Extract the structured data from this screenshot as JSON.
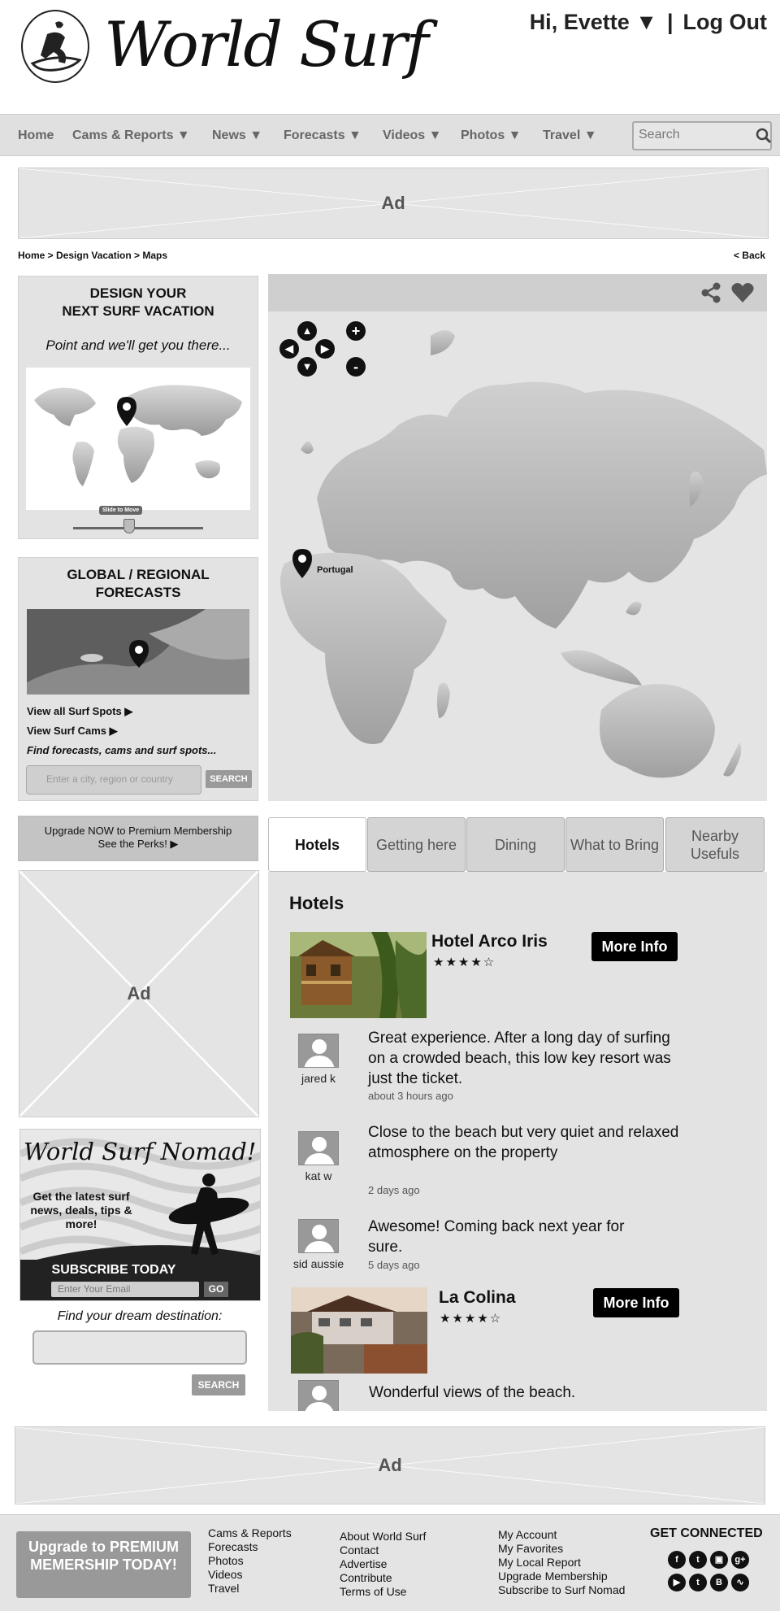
{
  "header": {
    "logo_text": "World Surf",
    "greeting": "Hi, Evette ▼",
    "separator": "|",
    "logout": "Log Out"
  },
  "nav": {
    "items": [
      "Home",
      "Cams & Reports ▼",
      "News ▼",
      "Forecasts ▼",
      "Videos ▼",
      "Photos ▼",
      "Travel ▼"
    ],
    "search_placeholder": "Search"
  },
  "ads": {
    "label": "Ad"
  },
  "breadcrumb": "Home > Design Vacation > Maps",
  "back": "< Back",
  "design_panel": {
    "title_line1": "DESIGN YOUR",
    "title_line2": "NEXT SURF VACATION",
    "tagline": "Point and we'll get you there...",
    "slider_label": "Slide to Move"
  },
  "forecast_panel": {
    "title_line1": "GLOBAL / REGIONAL",
    "title_line2": "FORECASTS",
    "link_spots": "View all Surf Spots ▶",
    "link_cams": "View Surf Cams ▶",
    "find_text": "Find forecasts, cams and surf spots...",
    "input_placeholder": "Enter a city, region or country",
    "search_button": "SEARCH"
  },
  "map": {
    "pin_label": "Portugal",
    "zoom_in": "+",
    "zoom_out": "-"
  },
  "promo": {
    "line1": "Upgrade NOW to Premium Membership",
    "line2": "See the Perks! ▶"
  },
  "tabs": [
    {
      "label": "Hotels",
      "active": true
    },
    {
      "label": "Getting here",
      "active": false
    },
    {
      "label": "Dining",
      "active": false
    },
    {
      "label": "What to Bring",
      "active": false
    },
    {
      "label": "Nearby Usefuls",
      "active": false
    }
  ],
  "hotels_section": {
    "title": "Hotels",
    "hotels": [
      {
        "name": "Hotel Arco Iris",
        "stars": "★★★★☆",
        "rating": 4,
        "button": "More Info",
        "reviews": [
          {
            "user": "jared k",
            "text": "Great experience. After a long day of surfing on a crowded beach, this low key resort was just the ticket.",
            "time": "about 3 hours ago"
          },
          {
            "user": "kat w",
            "text": "Close to the beach but very quiet and relaxed atmosphere on the property",
            "time": "2 days ago"
          },
          {
            "user": "sid aussie",
            "text": "Awesome! Coming back next year for sure.",
            "time": "5 days ago"
          }
        ]
      },
      {
        "name": "La Colina",
        "stars": "★★★★☆",
        "rating": 4,
        "button": "More Info",
        "reviews": [
          {
            "text": "Wonderful views of the beach."
          }
        ]
      }
    ]
  },
  "nomad": {
    "title": "World Surf Nomad!",
    "desc": "Get the latest surf news, deals, tips & more!",
    "subscribe": "SUBSCRIBE TODAY",
    "email_placeholder": "Enter Your Email",
    "go": "GO"
  },
  "dream": {
    "label": "Find your dream destination:",
    "button": "SEARCH"
  },
  "footer": {
    "upgrade": "Upgrade to PREMIUM MEMERSHIP TODAY!",
    "col1": [
      "Cams & Reports",
      "Forecasts",
      "Photos",
      "Videos",
      "Travel"
    ],
    "col2": [
      "About World Surf",
      "Contact",
      "Advertise",
      "Contribute",
      "Terms of Use"
    ],
    "col3": [
      "My Account",
      "My Favorites",
      "My Local Report",
      "Upgrade Membership",
      "Subscribe to Surf Nomad"
    ],
    "get_connected": "GET CONNECTED",
    "social_icons": [
      "facebook-icon",
      "twitter-icon",
      "instagram-icon",
      "google-plus-icon",
      "youtube-icon",
      "tumblr-icon",
      "blogger-icon",
      "rss-icon"
    ]
  },
  "colors": {
    "panel": "#e3e3e3",
    "nav": "#e0e0e0",
    "button_dark": "#000000",
    "button_gray": "#9a9a9a"
  }
}
